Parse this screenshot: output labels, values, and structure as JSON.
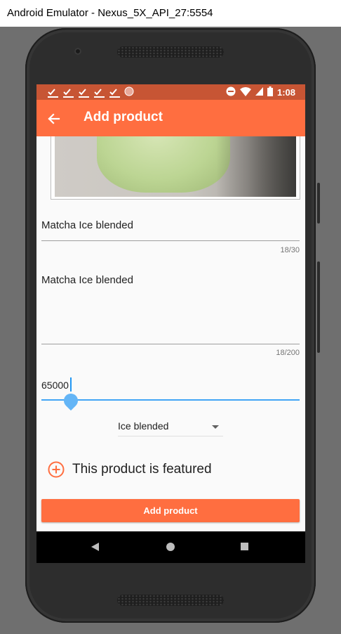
{
  "window": {
    "title": "Android Emulator - Nexus_5X_API_27:5554"
  },
  "status_bar": {
    "time": "1:08",
    "left_icons": [
      "checklist-icon",
      "checklist-icon",
      "checklist-icon",
      "checklist-icon",
      "checklist-icon",
      "circle-icon"
    ],
    "right_icons": [
      "do-not-disturb-icon",
      "wifi-icon",
      "signal-icon",
      "battery-icon"
    ]
  },
  "app_bar": {
    "title": "Add product",
    "back_icon": "arrow-back-icon"
  },
  "form": {
    "name": {
      "value": "Matcha Ice blended",
      "counter": "18/30"
    },
    "description": {
      "value": "Matcha Ice blended",
      "counter": "18/200"
    },
    "price": {
      "value": "65000"
    },
    "category": {
      "selected": "Ice blended"
    },
    "featured": {
      "label": "This product is featured",
      "icon": "add-circle-outline-icon"
    },
    "submit": {
      "label": "Add product"
    }
  },
  "nav_bar": {
    "buttons": [
      "back-triangle-icon",
      "home-circle-icon",
      "recents-square-icon"
    ]
  },
  "colors": {
    "primary": "#ff6e40",
    "status_bar": "#c75534",
    "accent": "#42a5f5"
  }
}
